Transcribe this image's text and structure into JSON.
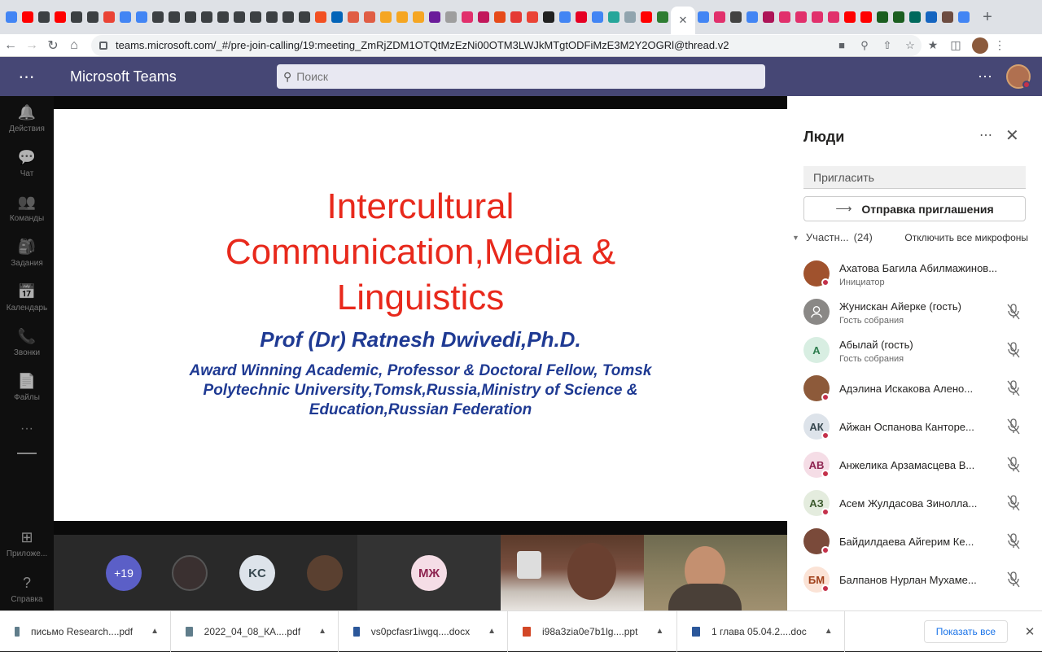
{
  "browser": {
    "tabs": [
      {
        "icon": "translate-icon",
        "color": "#4285f4"
      },
      {
        "icon": "youtube-icon",
        "color": "#ff0000"
      },
      {
        "icon": "site-icon",
        "color": "#3c4043"
      },
      {
        "icon": "youtube-icon",
        "color": "#ff0000"
      },
      {
        "icon": "site-icon",
        "color": "#3c4043"
      },
      {
        "icon": "site-icon",
        "color": "#3c4043"
      },
      {
        "icon": "gmail-icon",
        "color": "#ea4335"
      },
      {
        "icon": "docs-icon",
        "color": "#4285f4"
      },
      {
        "icon": "docs-icon",
        "color": "#4285f4"
      },
      {
        "icon": "site-icon",
        "color": "#3c4043"
      },
      {
        "icon": "site-icon",
        "color": "#3c4043"
      },
      {
        "icon": "site-icon",
        "color": "#3c4043"
      },
      {
        "icon": "site-icon",
        "color": "#3c4043"
      },
      {
        "icon": "site-icon",
        "color": "#3c4043"
      },
      {
        "icon": "site-icon",
        "color": "#3c4043"
      },
      {
        "icon": "site-icon",
        "color": "#3c4043"
      },
      {
        "icon": "site-icon",
        "color": "#3c4043"
      },
      {
        "icon": "site-icon",
        "color": "#3c4043"
      },
      {
        "icon": "site-icon",
        "color": "#3c4043"
      },
      {
        "icon": "windows-icon",
        "color": "#f25022"
      },
      {
        "icon": "onedrive-icon",
        "color": "#0364b8"
      },
      {
        "icon": "fork-icon",
        "color": "#e05d44"
      },
      {
        "icon": "fork-icon",
        "color": "#e05d44"
      },
      {
        "icon": "hand-icon",
        "color": "#f5a623"
      },
      {
        "icon": "hand-icon",
        "color": "#f5a623"
      },
      {
        "icon": "hand-icon",
        "color": "#f5a623"
      },
      {
        "icon": "mail-icon",
        "color": "#6a1b9a"
      },
      {
        "icon": "ar-icon",
        "color": "#9e9e9e"
      },
      {
        "icon": "instagram-icon",
        "color": "#e1306c"
      },
      {
        "icon": "circle-icon",
        "color": "#c2185b"
      },
      {
        "icon": "circle-icon",
        "color": "#e64a19"
      },
      {
        "icon": "s-icon",
        "color": "#e53935"
      },
      {
        "icon": "gmail-icon",
        "color": "#ea4335"
      },
      {
        "icon": "face-icon",
        "color": "#212121"
      },
      {
        "icon": "translate-icon",
        "color": "#4285f4"
      },
      {
        "icon": "pinterest-icon",
        "color": "#e60023"
      },
      {
        "icon": "google-icon",
        "color": "#4285f4"
      },
      {
        "icon": "arrow-icon",
        "color": "#26a69a"
      },
      {
        "icon": "doc-icon",
        "color": "#90a4ae"
      },
      {
        "icon": "youtube-icon",
        "color": "#ff0000"
      },
      {
        "icon": "dollar-icon",
        "color": "#2e7d32"
      }
    ],
    "tabs_after": [
      {
        "icon": "docs-icon",
        "color": "#4285f4"
      },
      {
        "icon": "instagram-icon",
        "color": "#e1306c"
      },
      {
        "icon": "cat-icon",
        "color": "#424242"
      },
      {
        "icon": "google-icon",
        "color": "#4285f4"
      },
      {
        "icon": "star-icon",
        "color": "#ad1457"
      },
      {
        "icon": "instagram-icon",
        "color": "#e1306c"
      },
      {
        "icon": "instagram-icon",
        "color": "#e1306c"
      },
      {
        "icon": "instagram-icon",
        "color": "#e1306c"
      },
      {
        "icon": "instagram-icon",
        "color": "#e1306c"
      },
      {
        "icon": "youtube-icon",
        "color": "#ff0000"
      },
      {
        "icon": "youtube-icon",
        "color": "#ff0000"
      },
      {
        "icon": "egov-icon",
        "color": "#1b5e20"
      },
      {
        "icon": "egov-icon",
        "color": "#1b5e20"
      },
      {
        "icon": "chart-icon",
        "color": "#00695c"
      },
      {
        "icon": "gear-icon",
        "color": "#1565c0"
      },
      {
        "icon": "film-icon",
        "color": "#6d4c41"
      },
      {
        "icon": "translate-icon",
        "color": "#4285f4"
      }
    ],
    "url": "teams.microsoft.com/_#/pre-join-calling/19:meeting_ZmRjZDM1OTQtMzEzNi00OTM3LWJkMTgtODFiMzE3M2Y2OGRl@thread.v2"
  },
  "teams": {
    "brand": "Microsoft Teams",
    "search_placeholder": "Поиск",
    "accent": "#464775",
    "rail": [
      {
        "label": "Действия",
        "icon": "bell-icon",
        "glyph": "🔔"
      },
      {
        "label": "Чат",
        "icon": "chat-icon",
        "glyph": "💬"
      },
      {
        "label": "Команды",
        "icon": "teams-icon",
        "glyph": "👥"
      },
      {
        "label": "Задания",
        "icon": "assignments-icon",
        "glyph": "🎒"
      },
      {
        "label": "Календарь",
        "icon": "calendar-icon",
        "glyph": "📅"
      },
      {
        "label": "Звонки",
        "icon": "phone-icon",
        "glyph": "📞"
      },
      {
        "label": "Файлы",
        "icon": "file-icon",
        "glyph": "📄"
      }
    ],
    "rail_bottom": [
      {
        "label": "Приложе...",
        "icon": "apps-icon",
        "glyph": "⊞"
      },
      {
        "label": "Справка",
        "icon": "help-icon",
        "glyph": "?"
      }
    ]
  },
  "slide": {
    "title_lines": [
      "Intercultural",
      "Communication,Media &",
      "Linguistics"
    ],
    "author": "Prof (Dr) Ratnesh Dwivedi,Ph.D.",
    "affiliation": "Award Winning Academic, Professor & Doctoral Fellow, Tomsk Polytechnic University,Tomsk,Russia,Ministry of Science & Education,Russian Federation"
  },
  "gallery": {
    "overflow": "+19",
    "initials_kc": "KC",
    "initials_mzh": "МЖ"
  },
  "people": {
    "title": "Люди",
    "invite_placeholder": "Пригласить",
    "share_label": "Отправка приглашения",
    "section_label": "Участн...",
    "count": "(24)",
    "mute_all": "Отключить все микрофоны",
    "participants": [
      {
        "name": "Ахатова Багила Абилмажинов...",
        "role": "Инициатор",
        "initials": "",
        "bg": "#a0522d",
        "fg": "#fff",
        "photo": true,
        "mic": false
      },
      {
        "name": "Жунискан Айерке (гость)",
        "role": "Гость собрания",
        "initials": "",
        "bg": "#8a8886",
        "fg": "#fff",
        "photo": false,
        "guest": true,
        "mic": true
      },
      {
        "name": "Абылай (гость)",
        "role": "Гость собрания",
        "initials": "A",
        "bg": "#d8eee2",
        "fg": "#2e7d4f",
        "photo": false,
        "mic": true
      },
      {
        "name": "Адэлина Искакова Алено...",
        "role": "",
        "initials": "",
        "bg": "#8d5a3a",
        "fg": "#fff",
        "photo": true,
        "mic": true
      },
      {
        "name": "Айжан Оспанова Канторе...",
        "role": "",
        "initials": "АК",
        "bg": "#dde3ea",
        "fg": "#37474f",
        "photo": false,
        "mic": true
      },
      {
        "name": "Анжелика Арзамасцева В...",
        "role": "",
        "initials": "АВ",
        "bg": "#f5dde6",
        "fg": "#8e2450",
        "photo": false,
        "mic": true
      },
      {
        "name": "Асем Жулдасова Зинолла...",
        "role": "",
        "initials": "АЗ",
        "bg": "#e4ecde",
        "fg": "#3c5a2e",
        "photo": false,
        "mic": true
      },
      {
        "name": "Байдилдаева Айгерим Ке...",
        "role": "",
        "initials": "",
        "bg": "#7a4a3a",
        "fg": "#fff",
        "photo": true,
        "mic": true
      },
      {
        "name": "Балпанов Нурлан Мухаме...",
        "role": "",
        "initials": "БМ",
        "bg": "#fbe3d6",
        "fg": "#a0401a",
        "photo": false,
        "mic": true
      }
    ]
  },
  "downloads": {
    "items": [
      {
        "name": "письмо Research....pdf",
        "type": "pdf",
        "color": "#607d8b"
      },
      {
        "name": "2022_04_08_КА....pdf",
        "type": "pdf",
        "color": "#607d8b"
      },
      {
        "name": "vs0pcfasr1iwgq....docx",
        "type": "docx",
        "color": "#2b579a"
      },
      {
        "name": "i98a3zia0e7b1lg....ppt",
        "type": "ppt",
        "color": "#d24726"
      },
      {
        "name": "1 глава 05.04.2....doc",
        "type": "doc",
        "color": "#2b579a"
      }
    ],
    "show_all": "Показать все"
  }
}
